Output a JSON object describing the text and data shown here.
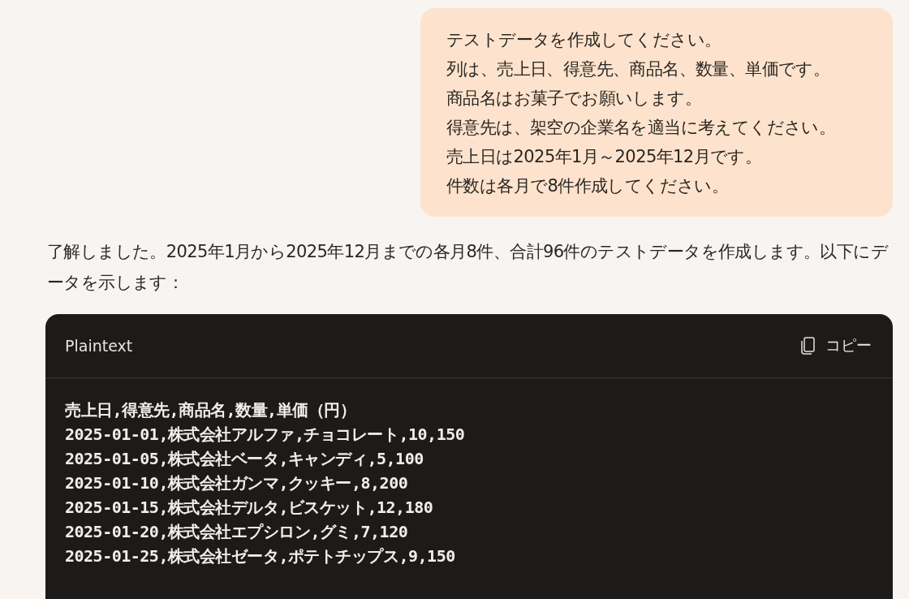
{
  "user_message": {
    "lines": [
      "テストデータを作成してください。",
      "列は、売上日、得意先、商品名、数量、単価です。",
      "商品名はお菓子でお願いします。",
      "得意先は、架空の企業名を適当に考えてください。",
      "売上日は2025年1月～2025年12月です。",
      "件数は各月で8件作成してください。"
    ]
  },
  "assistant_message": {
    "text": "了解しました。2025年1月から2025年12月までの各月8件、合計96件のテストデータを作成します。以下にデータを示します："
  },
  "code_block": {
    "language": "Plaintext",
    "copy_label": "コピー",
    "lines": [
      "売上日,得意先,商品名,数量,単価（円）",
      "2025-01-01,株式会社アルファ,チョコレート,10,150",
      "2025-01-05,株式会社ベータ,キャンディ,5,100",
      "2025-01-10,株式会社ガンマ,クッキー,8,200",
      "2025-01-15,株式会社デルタ,ビスケット,12,180",
      "2025-01-20,株式会社エプシロン,グミ,7,120",
      "2025-01-25,株式会社ゼータ,ポテトチップス,9,150"
    ]
  }
}
